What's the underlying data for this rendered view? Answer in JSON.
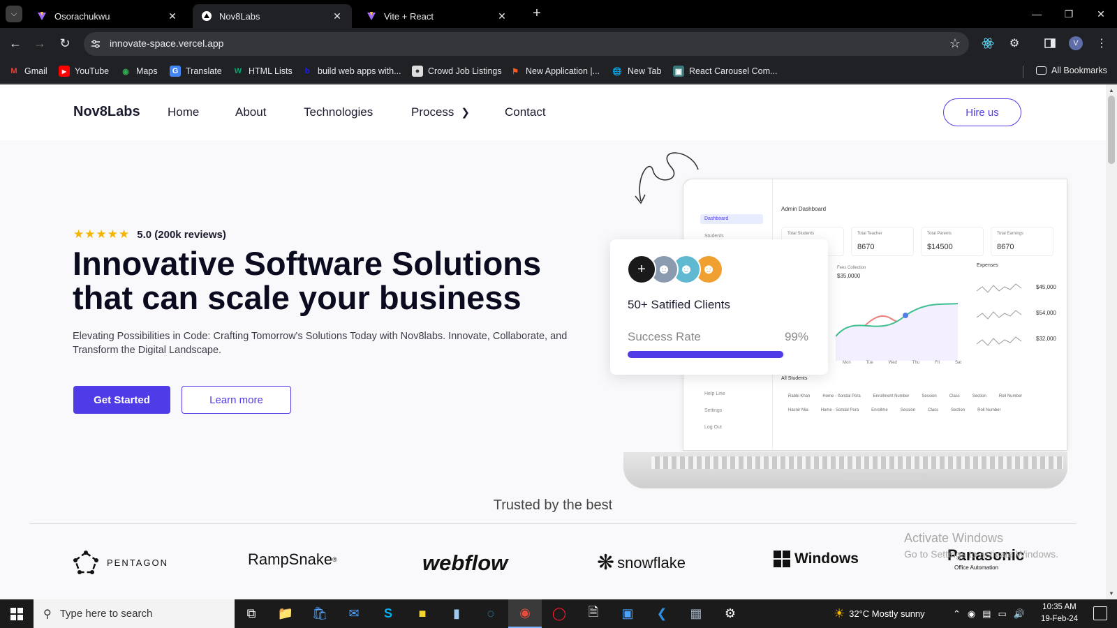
{
  "browser": {
    "tabs": [
      {
        "title": "Osorachukwu",
        "active": false
      },
      {
        "title": "Nov8Labs",
        "active": true
      },
      {
        "title": "Vite + React",
        "active": false
      }
    ],
    "url": "innovate-space.vercel.app",
    "bookmarks": [
      {
        "label": "Gmail",
        "icon": "gmail-icon",
        "color": "#ea4335"
      },
      {
        "label": "YouTube",
        "icon": "youtube-icon",
        "color": "#ff0000"
      },
      {
        "label": "Maps",
        "icon": "maps-icon",
        "color": "#34a853"
      },
      {
        "label": "Translate",
        "icon": "translate-icon",
        "color": "#4285f4"
      },
      {
        "label": "HTML Lists",
        "icon": "w3-icon",
        "color": "#04aa6d"
      },
      {
        "label": "build web apps with...",
        "icon": "bubble-icon",
        "color": "#1a1aff"
      },
      {
        "label": "Crowd Job Listings",
        "icon": "crowd-icon",
        "color": "#bbbbbb"
      },
      {
        "label": "New Application |...",
        "icon": "flag-icon",
        "color": "#ff5722"
      },
      {
        "label": "New Tab",
        "icon": "globe-icon",
        "color": "#ffffff"
      },
      {
        "label": "React Carousel Com...",
        "icon": "react-carousel-icon",
        "color": "#61dafb"
      }
    ],
    "all_bookmarks": "All Bookmarks",
    "profile_initial": "V"
  },
  "site": {
    "logo": "Nov8Labs",
    "nav": [
      "Home",
      "About",
      "Technologies",
      "Process",
      "Contact"
    ],
    "hire": "Hire us",
    "rating_text": "5.0 (200k reviews)",
    "rating_stars": 5,
    "headline_1": "Innovative Software Solutions",
    "headline_2": "that can scale your business",
    "subtext": "Elevating Possibilities in Code: Crafting Tomorrow's Solutions Today with Nov8labs. Innovate, Collaborate, and Transform the Digital Landscape.",
    "cta_primary": "Get Started",
    "cta_secondary": "Learn more",
    "accent": "#4f3ce6",
    "clients_card": {
      "title": "50+ Satified Clients",
      "success_label": "Success Rate",
      "success_value": "99%",
      "success_fraction": 0.99
    },
    "dashboard": {
      "title": "Admin Dashboard",
      "side": [
        "Dashboard",
        "Students",
        "Help Line",
        "Settings",
        "Log Out"
      ],
      "stats": [
        {
          "label": "Total Students",
          "value": ""
        },
        {
          "label": "Total Teacher",
          "value": "8670"
        },
        {
          "label": "Total Parents",
          "value": "$14500"
        },
        {
          "label": "Total Earnings",
          "value": "8670"
        }
      ],
      "fees_label": "Fees Collection",
      "fees_value": "$35,0000",
      "expenses_title": "Expenses",
      "expenses": [
        "$45,000",
        "$54,000",
        "$32,000"
      ],
      "months": [
        "Mon",
        "Tue",
        "Wed",
        "Thu",
        "Fri",
        "Sat"
      ],
      "students_title": "All Students",
      "students": [
        {
          "name": "Rabbi Khan",
          "address": "Home - Sondal Pora",
          "enroll": "Enrollment Number",
          "session": "Session",
          "class": "Class",
          "section": "Section",
          "roll": "Roll Number"
        },
        {
          "name": "Hasnir Mia",
          "address": "Home - Sondal Pora",
          "enroll": "Enrollme",
          "session": "Session",
          "class": "Class",
          "section": "Section",
          "roll": "Roll Number"
        }
      ]
    },
    "trusted": "Trusted by the best",
    "brands": [
      "PENTAGON",
      "RampSnake",
      "webflow",
      "snowflake",
      "Windows",
      "Panasonic"
    ],
    "panasonic_sub": "Office Automation"
  },
  "watermark": {
    "line1": "Activate Windows",
    "line2": "Go to Settings to activate Windows."
  },
  "taskbar": {
    "search_placeholder": "Type here to search",
    "weather": "32°C  Mostly sunny",
    "time": "10:35 AM",
    "date": "19-Feb-24"
  }
}
